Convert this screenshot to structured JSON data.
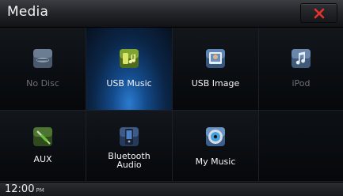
{
  "header": {
    "title": "Media",
    "close_icon": "close-x-icon",
    "close_color": "#e8322b"
  },
  "tiles": [
    {
      "label": "No Disc",
      "icon": "disc-icon",
      "state": "disabled"
    },
    {
      "label": "USB Music",
      "icon": "usb-music-icon",
      "state": "selected"
    },
    {
      "label": "USB Image",
      "icon": "usb-image-icon",
      "state": "normal"
    },
    {
      "label": "iPod",
      "icon": "ipod-music-icon",
      "state": "disabled"
    },
    {
      "label": "AUX",
      "icon": "aux-cable-icon",
      "state": "normal"
    },
    {
      "label": "Bluetooth\nAudio",
      "icon": "bluetooth-audio-icon",
      "state": "normal"
    },
    {
      "label": "My Music",
      "icon": "my-music-icon",
      "state": "normal"
    }
  ],
  "status": {
    "time": "12:00",
    "ampm": "PM"
  },
  "colors": {
    "accent_blue": "#2b7bd0",
    "disabled_text": "#6a7079"
  }
}
